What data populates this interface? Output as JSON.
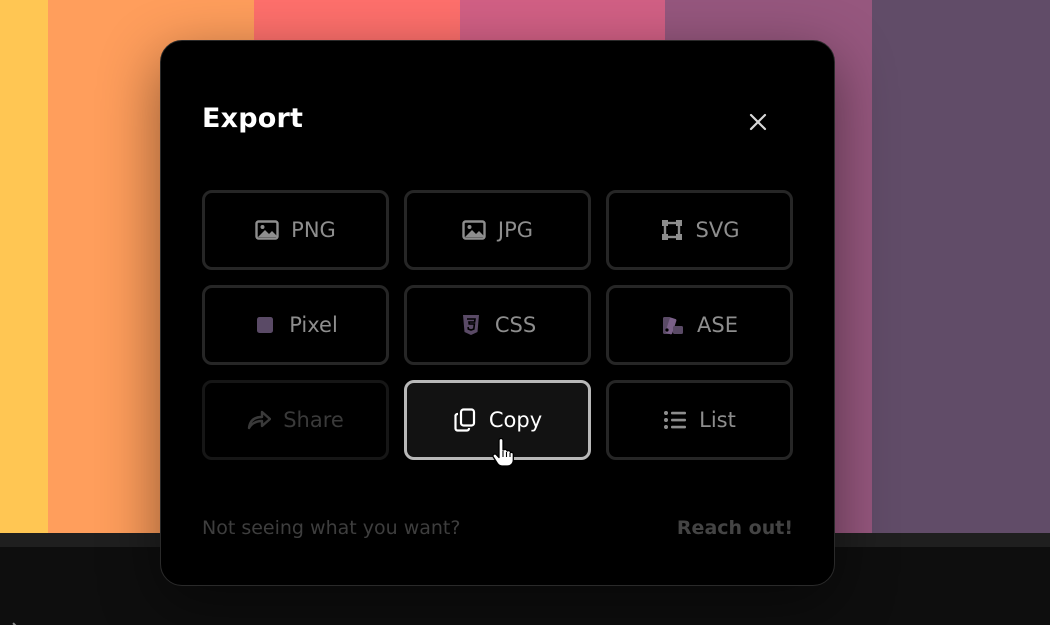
{
  "palette": {
    "colors": [
      "#FFC653",
      "#FF9E5C",
      "#FF706C",
      "#D26085",
      "#96577E",
      "#614C68"
    ]
  },
  "dialog": {
    "title": "Export",
    "close_icon": "close-icon"
  },
  "options": [
    {
      "label": "PNG",
      "icon": "image-icon",
      "state": "default"
    },
    {
      "label": "JPG",
      "icon": "image-icon",
      "state": "default"
    },
    {
      "label": "SVG",
      "icon": "vector-icon",
      "state": "default"
    },
    {
      "label": "Pixel",
      "icon": "pixel-square-icon",
      "state": "default"
    },
    {
      "label": "CSS",
      "icon": "css3-icon",
      "state": "default"
    },
    {
      "label": "ASE",
      "icon": "swatches-icon",
      "state": "default"
    },
    {
      "label": "Share",
      "icon": "share-arrow-icon",
      "state": "disabled"
    },
    {
      "label": "Copy",
      "icon": "copy-icon",
      "state": "active"
    },
    {
      "label": "List",
      "icon": "list-icon",
      "state": "default"
    }
  ],
  "footer": {
    "prompt": "Not seeing what you want?",
    "link": "Reach out!"
  }
}
